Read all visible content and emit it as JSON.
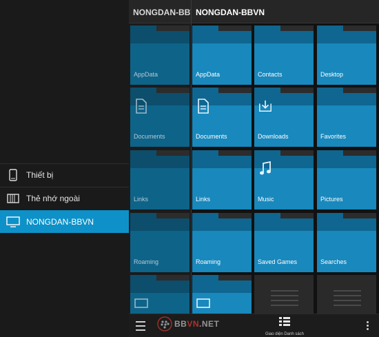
{
  "sidebar": {
    "items": [
      {
        "label": "Thiết bị",
        "icon": "phone-icon"
      },
      {
        "label": "Thẻ nhớ ngoài",
        "icon": "memory-card-icon"
      },
      {
        "label": "NONGDAN-BBVN",
        "icon": "monitor-icon",
        "active": true
      }
    ]
  },
  "mid_panel": {
    "title": "NONGDAN-BBVN",
    "tiles": [
      "AppData",
      "Documents",
      "Links",
      "Roaming",
      ""
    ]
  },
  "main_panel": {
    "title": "NONGDAN-BBVN",
    "tiles": [
      {
        "label": "AppData",
        "icon": "folder-icon"
      },
      {
        "label": "Contacts",
        "icon": "folder-icon"
      },
      {
        "label": "Desktop",
        "icon": "folder-icon"
      },
      {
        "label": "Documents",
        "icon": "document-icon"
      },
      {
        "label": "Downloads",
        "icon": "download-icon"
      },
      {
        "label": "Favorites",
        "icon": "folder-icon"
      },
      {
        "label": "Links",
        "icon": "folder-icon"
      },
      {
        "label": "Music",
        "icon": "music-note-icon"
      },
      {
        "label": "Pictures",
        "icon": "folder-icon"
      },
      {
        "label": "Roaming",
        "icon": "folder-icon"
      },
      {
        "label": "Saved Games",
        "icon": "folder-icon"
      },
      {
        "label": "Searches",
        "icon": "folder-icon"
      }
    ]
  },
  "bottom_bar": {
    "view_label": "Giao diện Danh sách"
  },
  "watermark": {
    "prefix": "BB",
    "highlight": "VN",
    "suffix": ".NET"
  },
  "colors": {
    "accent": "#0e91c8",
    "folder_front": "#1988bc",
    "folder_back": "#0f6690",
    "background": "#141414"
  }
}
